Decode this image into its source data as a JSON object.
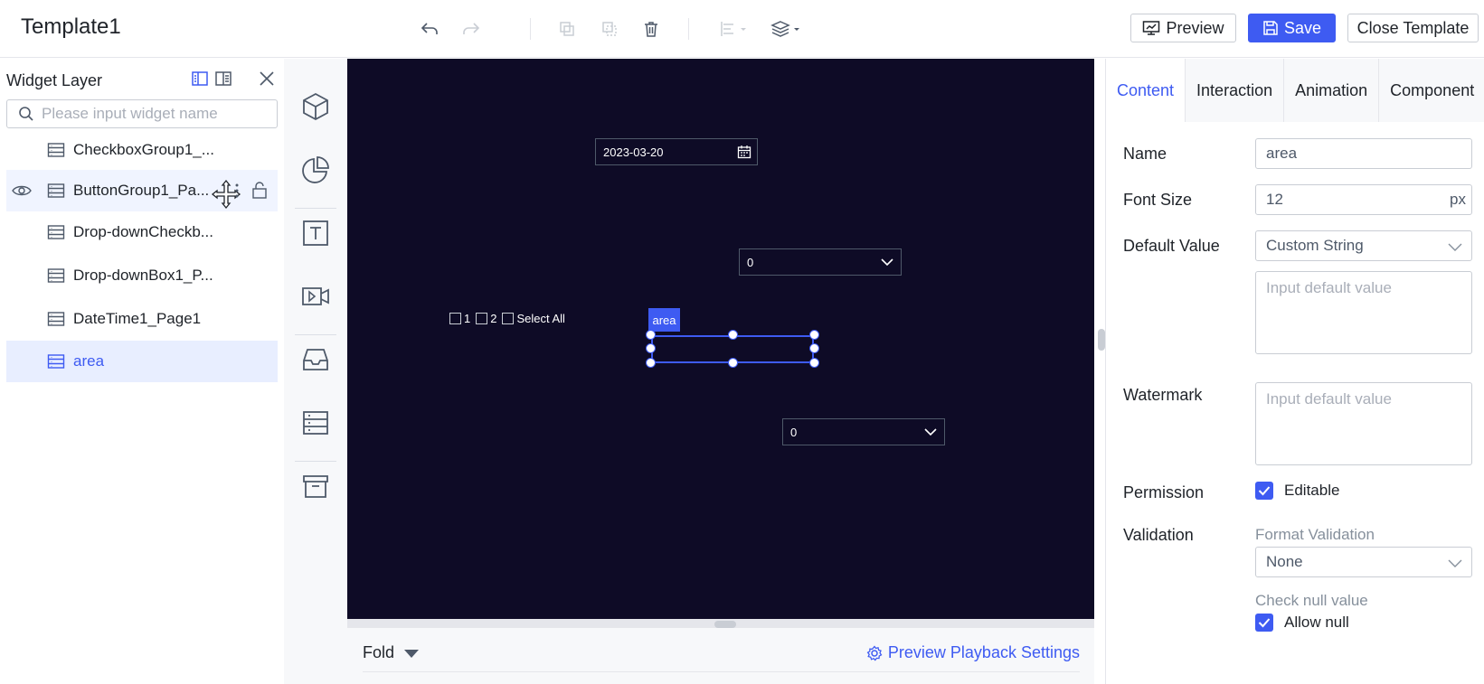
{
  "app": {
    "title": "Template1"
  },
  "toolbar": {
    "preview_label": "Preview",
    "save_label": "Save",
    "close_label": "Close Template",
    "accent": "#3e5bf2"
  },
  "layer_panel": {
    "title": "Widget Layer",
    "search_placeholder": "Please input widget name",
    "items": [
      {
        "label": "CheckboxGroup1_...",
        "state": "normal"
      },
      {
        "label": "ButtonGroup1_Pa...",
        "state": "hover"
      },
      {
        "label": "Drop-downCheckb...",
        "state": "normal"
      },
      {
        "label": "Drop-downBox1_P...",
        "state": "normal"
      },
      {
        "label": "DateTime1_Page1",
        "state": "normal"
      },
      {
        "label": "area",
        "state": "selected"
      }
    ]
  },
  "canvas": {
    "background": "#0e0b26",
    "date_value": "2023-03-20",
    "dropdown1_value": "0",
    "dropdown2_value": "0",
    "checkbox_labels": [
      "1",
      "2",
      "Select All"
    ],
    "selected_tag": "area"
  },
  "footer": {
    "fold_label": "Fold",
    "preview_settings_label": "Preview Playback Settings"
  },
  "properties": {
    "tabs": [
      "Content",
      "Interaction",
      "Animation",
      "Component"
    ],
    "active_tab": "Content",
    "name_label": "Name",
    "name_value": "area",
    "font_size_label": "Font Size",
    "font_size_value": "12",
    "font_size_unit": "px",
    "default_value_label": "Default Value",
    "default_value_select": "Custom String",
    "default_value_placeholder": "Input default value",
    "watermark_label": "Watermark",
    "watermark_placeholder": "Input default value",
    "permission_label": "Permission",
    "permission_option": "Editable",
    "validation_label": "Validation",
    "format_validation_label": "Format Validation",
    "format_validation_value": "None",
    "check_null_label": "Check null value",
    "allow_null_label": "Allow null"
  }
}
